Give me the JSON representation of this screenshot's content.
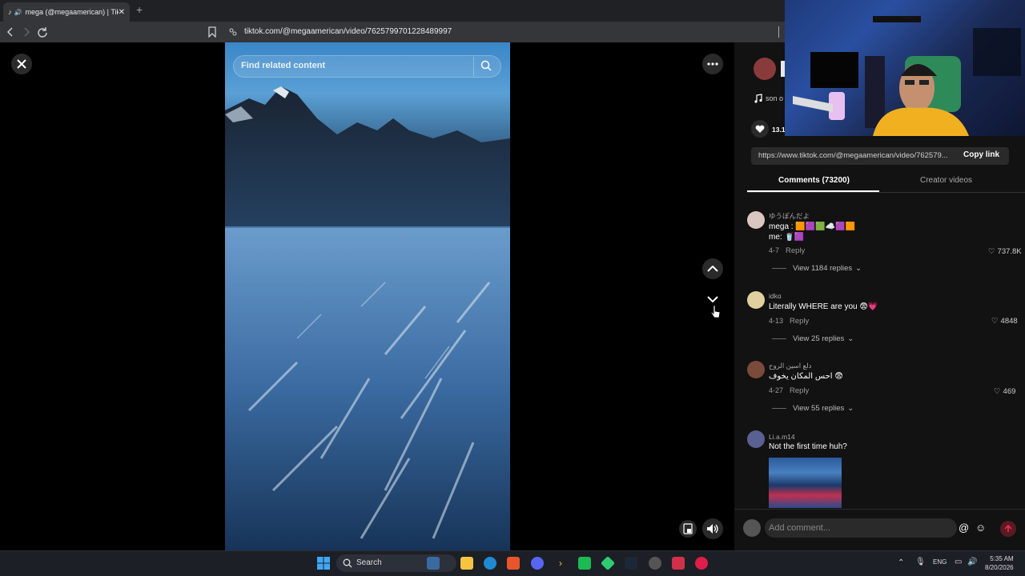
{
  "browser": {
    "tab_title": "mega (@megaamerican) | Tik",
    "new_tab": "+",
    "url": "tiktok.com/@megaamerican/video/7625799701228489997"
  },
  "video": {
    "search_placeholder": "Find related content"
  },
  "author": {
    "likes_partial": "13.1",
    "sound_partial": "son o"
  },
  "share": {
    "link": "https://www.tiktok.com/@megaamerican/video/762579...",
    "copy_label": "Copy link"
  },
  "tabs": {
    "comments": "Comments (73200)",
    "creator": "Creator videos"
  },
  "comments": [
    {
      "user": "ゆうぽんだよ",
      "line1": "mega : 🟧🟪🟩☁️🟪🟧",
      "line2": "me: 🥤🟪",
      "date": "4-7",
      "reply": "Reply",
      "likes": "737.8K",
      "view_replies": "View 1184 replies",
      "avatar_color": "#d8c8c0"
    },
    {
      "user": "idkɑ",
      "line1": "Literally WHERE are you 😨💗",
      "date": "4-13",
      "reply": "Reply",
      "likes": "4848",
      "view_replies": "View 25 replies",
      "avatar_color": "#e0d0a0"
    },
    {
      "user": "دلع اسين الروح",
      "line1": "احس المكان يخوف 😨",
      "date": "4-27",
      "reply": "Reply",
      "likes": "469",
      "view_replies": "View 55 replies",
      "avatar_color": "#7a4a3a"
    },
    {
      "user": "Li.a.m14",
      "line1": "Not the first time huh?",
      "avatar_color": "#5a6090"
    }
  ],
  "comment_bar": {
    "placeholder": "Add comment..."
  },
  "taskbar": {
    "search": "Search",
    "lang": "ENG",
    "time": "5:35 AM",
    "date": "8/20/2026"
  },
  "colors": {
    "accent_red": "#fe2c55",
    "panel_bg": "#121212"
  }
}
